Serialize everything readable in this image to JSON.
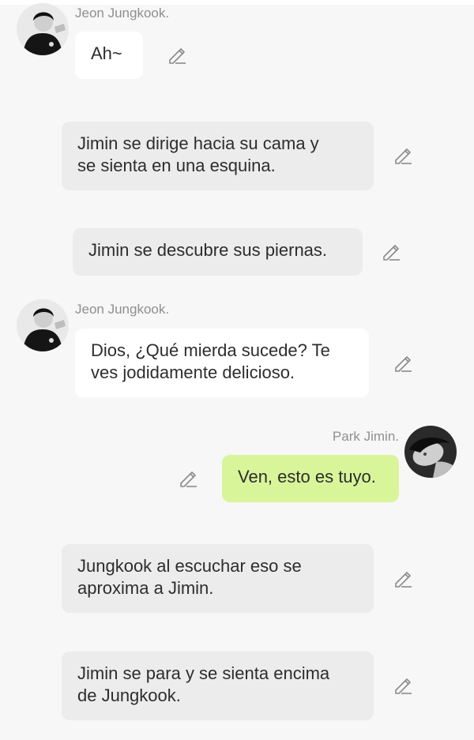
{
  "messages": [
    {
      "type": "character",
      "side": "left",
      "sender": "Jeon Jungkook.",
      "avatar_icon": "jungkook-avatar",
      "text": "Ah~"
    },
    {
      "type": "narration",
      "text": "Jimin se dirige hacia su cama y\nse sienta en una esquina."
    },
    {
      "type": "narration",
      "text": "Jimin se descubre sus piernas."
    },
    {
      "type": "character",
      "side": "left",
      "sender": "Jeon Jungkook.",
      "avatar_icon": "jungkook-avatar",
      "text": "Dios, ¿Qué mierda sucede? Te\nves jodidamente delicioso."
    },
    {
      "type": "character",
      "side": "right",
      "sender": "Park Jimin.",
      "avatar_icon": "jimin-avatar",
      "text": "Ven, esto es tuyo."
    },
    {
      "type": "narration",
      "text": "Jungkook al escuchar eso se\naproxima a Jimin."
    },
    {
      "type": "narration",
      "text": "Jimin se para y se sienta encima\nde Jungkook."
    }
  ],
  "icons": {
    "edit": "pencil-edit-icon"
  },
  "colors": {
    "background": "#f7f7f7",
    "character_bubble": "#ffffff",
    "narration_bubble": "#ececec",
    "self_bubble": "#d8f59a",
    "sender_name": "#8f8f8f"
  }
}
